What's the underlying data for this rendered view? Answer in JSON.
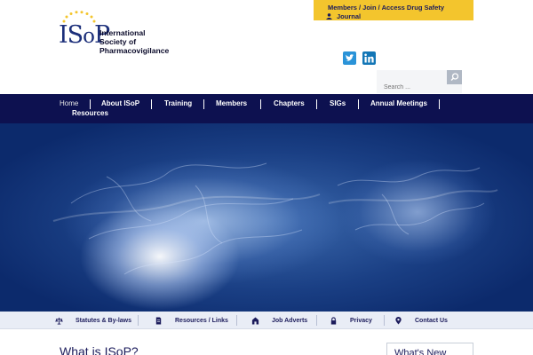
{
  "logo": {
    "word_i": "I",
    "word_s": "S",
    "word_o": "o",
    "word_p": "P",
    "star_color": "#f3c52d"
  },
  "org": {
    "line1": "International",
    "line2": "Society of",
    "line3": "Pharmacovigilance"
  },
  "members_box": {
    "line1": "Members / Join / Access Drug Safety",
    "line2": "Journal",
    "icon": "user-icon"
  },
  "social": {
    "twitter_icon": "twitter-icon",
    "linkedin_icon": "linkedin-icon"
  },
  "search": {
    "placeholder": "Search ...",
    "icon": "search-icon"
  },
  "nav": {
    "items": [
      "Home",
      "About ISoP",
      "Training",
      "Members",
      "Chapters",
      "SIGs",
      "Annual Meetings",
      "Resources"
    ],
    "active": "Home"
  },
  "bottom_links": {
    "items": [
      {
        "label": "Statutes & By-laws",
        "icon": "scales-icon"
      },
      {
        "label": "Resources / Links",
        "icon": "document-icon"
      },
      {
        "label": "Job Adverts",
        "icon": "building-icon"
      },
      {
        "label": "Privacy",
        "icon": "lock-icon"
      },
      {
        "label": "Contact Us",
        "icon": "location-pin-icon"
      }
    ]
  },
  "content": {
    "title": "What is ISoP?",
    "sidebar_title": "What's New"
  },
  "colors": {
    "nav_bg": "#0d1150",
    "accent_yellow": "#f3c52d",
    "brand_blue": "#1c2f7a"
  }
}
